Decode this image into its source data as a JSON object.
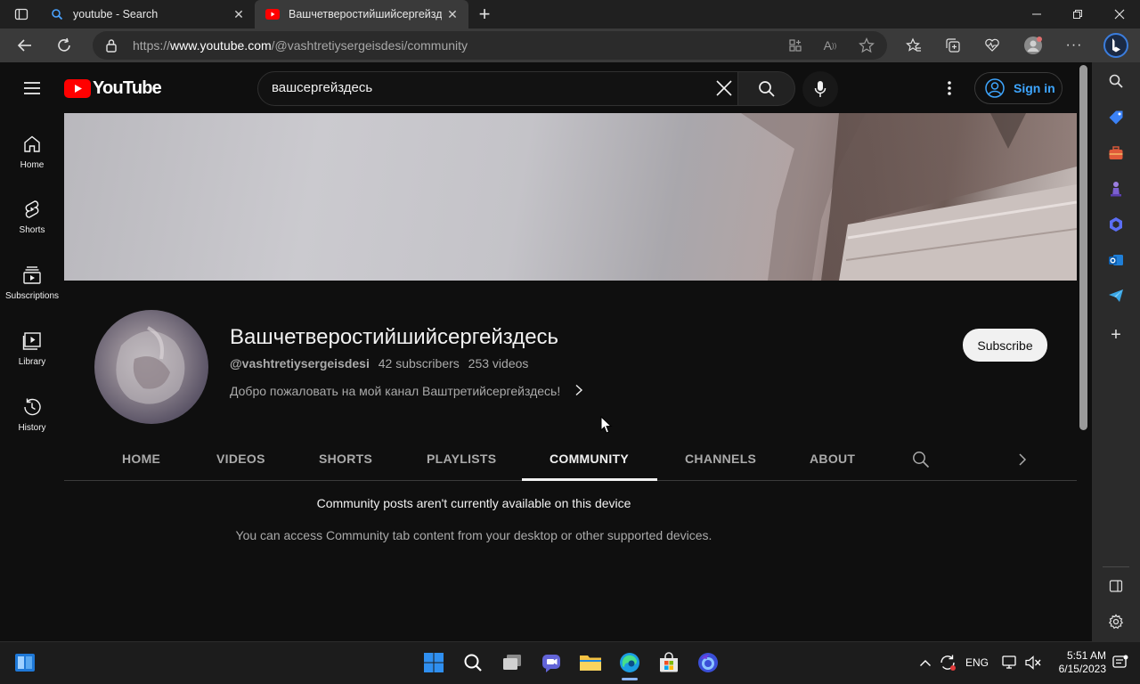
{
  "browser": {
    "tabs": [
      {
        "title": "youtube - Search",
        "active": false
      },
      {
        "title": "Вашчетверостийшийсергейздесь",
        "active": true
      }
    ],
    "url_prefix": "https://",
    "url_host": "www.youtube.com",
    "url_path": "/@vashtretiysergeisdesi/community"
  },
  "youtube": {
    "logo_text": "YouTube",
    "search_value": "вашсергейздесь",
    "sign_in": "Sign in",
    "guide": [
      {
        "label": "Home",
        "icon": "home-icon"
      },
      {
        "label": "Shorts",
        "icon": "shorts-icon"
      },
      {
        "label": "Subscriptions",
        "icon": "subscriptions-icon"
      },
      {
        "label": "Library",
        "icon": "library-icon"
      },
      {
        "label": "History",
        "icon": "history-icon"
      }
    ],
    "channel": {
      "name": "Вашчетверостийшийсергейздесь",
      "handle": "@vashtretiysergeisdesi",
      "subscribers": "42 subscribers",
      "videos": "253 videos",
      "description": "Добро пожаловать на мой канал Ваштретийсергейздесь!",
      "subscribe_label": "Subscribe"
    },
    "tabs": [
      "HOME",
      "VIDEOS",
      "SHORTS",
      "PLAYLISTS",
      "COMMUNITY",
      "CHANNELS",
      "ABOUT"
    ],
    "active_tab": "COMMUNITY",
    "message_title": "Community posts aren't currently available on this device",
    "message_body": "You can access Community tab content from your desktop or other supported devices."
  },
  "taskbar": {
    "language": "ENG",
    "time": "5:51 AM",
    "date": "6/15/2023"
  }
}
